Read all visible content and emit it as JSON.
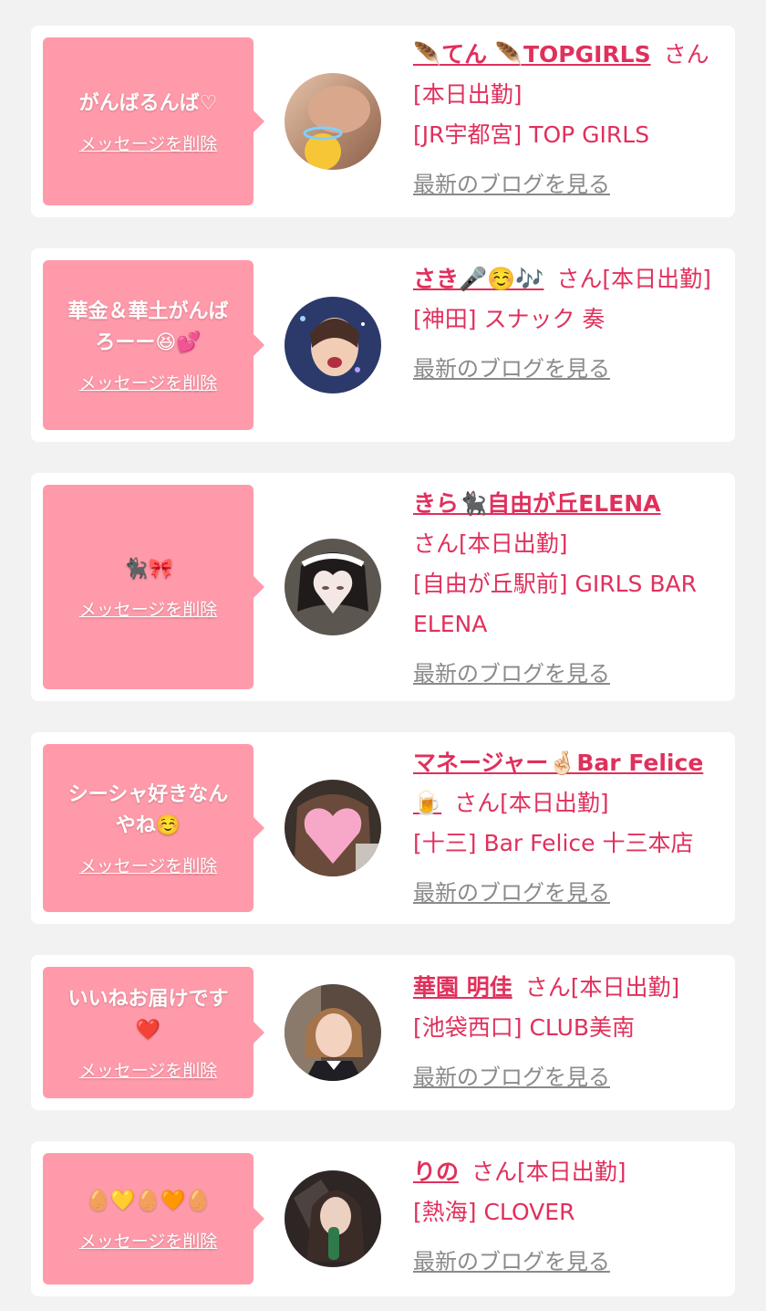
{
  "delete_label": "メッセージを削除",
  "blog_label": "最新のブログを見る",
  "entries": [
    {
      "message": "がんばるんば♡",
      "name": "🪶てん 🪶TOPGIRLS",
      "suffix": "さん[本日出勤]",
      "shop": "[JR宇都宮] TOP GIRLS",
      "avatar": "person-photo"
    },
    {
      "message": "華金＆華土がんば\nろーー😆💕",
      "name": "さき🎤☺️🎶",
      "suffix": "さん[本日出勤]",
      "shop": "[神田] スナック 奏",
      "avatar": "person-photo"
    },
    {
      "message": "🐈‍⬛🎀",
      "name": "きら🐈‍⬛自由が丘ELENA",
      "suffix": "さん[本日出勤]",
      "shop": "[自由が丘駅前] GIRLS BAR ELENA",
      "avatar": "person-photo"
    },
    {
      "message": "シーシャ好きなん\nやね☺️",
      "name": "マネージャー🤞🏻Bar Felice 🍺",
      "suffix": "さん[本日出勤]",
      "shop": "[十三] Bar Felice 十三本店",
      "avatar": "person-photo"
    },
    {
      "message": "いいねお届けです\n❤️",
      "name": "華園 明佳",
      "suffix": "さん[本日出勤]",
      "shop": "[池袋西口] CLUB美南",
      "avatar": "person-photo"
    },
    {
      "message": "🥚💛🥚🧡🥚",
      "name": "りの",
      "suffix": "さん[本日出勤]",
      "shop": "[熱海] CLOVER",
      "avatar": "person-photo"
    }
  ]
}
